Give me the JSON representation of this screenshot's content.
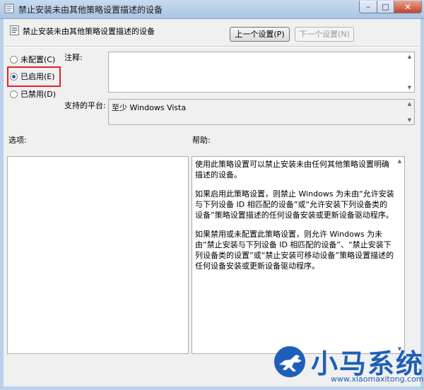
{
  "window": {
    "title": "禁止安装未由其他策略设置描述的设备",
    "min_label": "–",
    "max_label": "□",
    "close_label": "✕"
  },
  "header": {
    "policy_title": "禁止安装未由其他策略设置描述的设备",
    "prev_button": "上一个设置(P)",
    "next_button": "下一个设置(N)"
  },
  "state": {
    "options": [
      {
        "label": "未配置(C)",
        "checked": false
      },
      {
        "label": "已启用(E)",
        "checked": true
      },
      {
        "label": "已禁用(D)",
        "checked": false
      }
    ]
  },
  "comment": {
    "label": "注释:",
    "value": ""
  },
  "platform": {
    "label": "支持的平台:",
    "value": "至少 Windows Vista"
  },
  "options_section": {
    "label": "选项:"
  },
  "help": {
    "label": "帮助:",
    "paragraphs": [
      "使用此策略设置可以禁止安装未由任何其他策略设置明确描述的设备。",
      "如果启用此策略设置，则禁止 Windows 为未由“允许安装与下列设备 ID 相匹配的设备”或“允许安装下列设备类的设备”策略设置描述的任何设备安装或更新设备驱动程序。",
      "如果禁用或未配置此策略设置，则允许 Windows 为未由“禁止安装与下列设备 ID 相匹配的设备”、“禁止安装下列设备类的设置”或“禁止安装可移动设备”策略设置描述的任何设备安装或更新设备驱动程序。"
    ]
  },
  "watermark": {
    "title": "小马系统",
    "url": "www.xiaomaxitong.com"
  },
  "colors": {
    "highlight": "#e5202a",
    "brand": "#1f5fb8"
  }
}
